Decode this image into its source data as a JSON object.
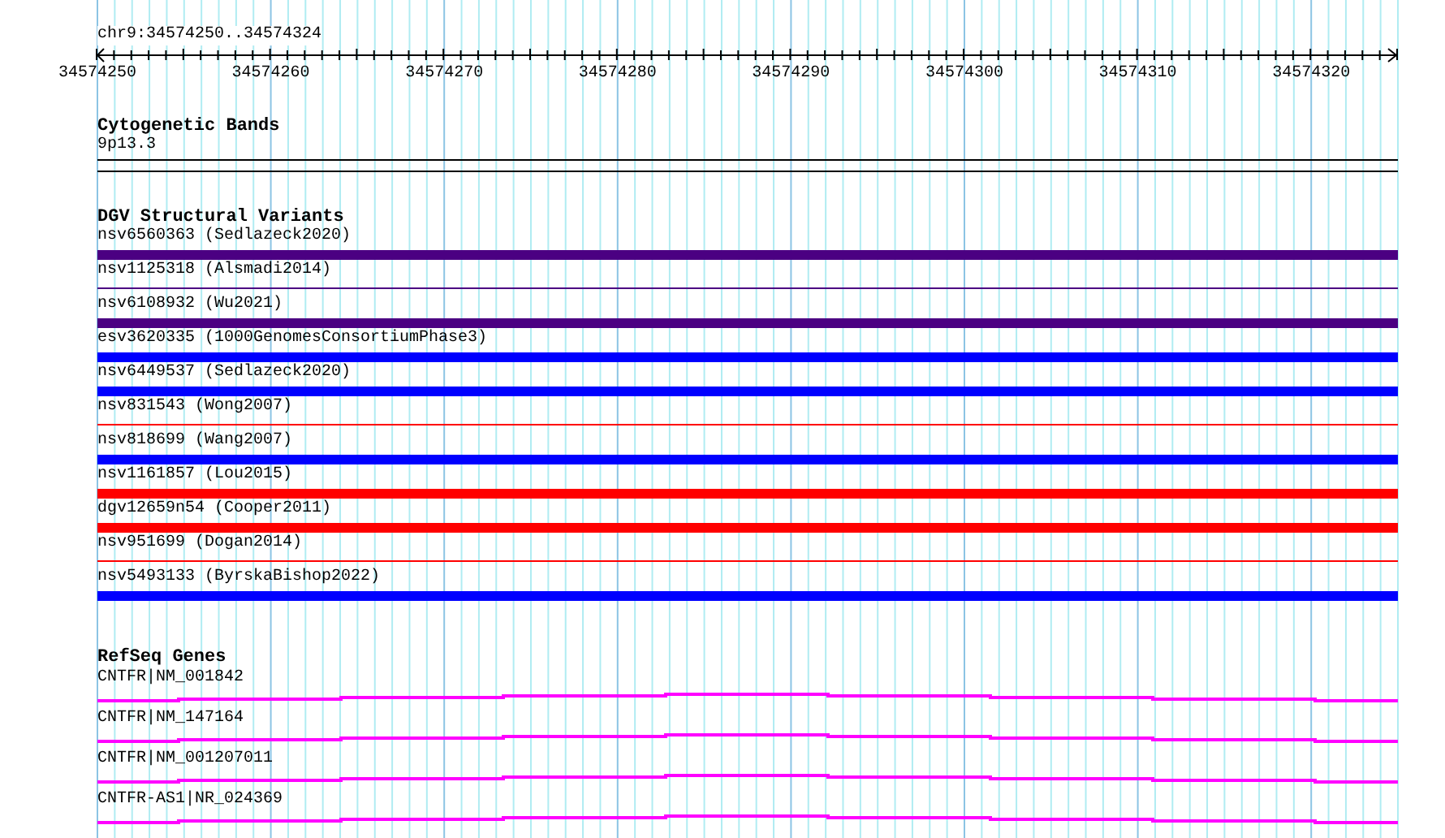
{
  "position": "chr9:34574250..34574324",
  "ruler": {
    "labels": [
      "34574250",
      "34574260",
      "34574270",
      "34574280",
      "34574290",
      "34574300",
      "34574310",
      "34574320"
    ]
  },
  "cytobands": {
    "title": "Cytogenetic Bands",
    "band": "9p13.3"
  },
  "variants": {
    "title": "DGV Structural Variants",
    "items": [
      {
        "label": "nsv6560363 (Sedlazeck2020)",
        "color": "#4b0082",
        "kind": "thick"
      },
      {
        "label": "nsv1125318 (Alsmadi2014)",
        "color": "#4b0082",
        "kind": "thin"
      },
      {
        "label": "nsv6108932 (Wu2021)",
        "color": "#4b0082",
        "kind": "thick"
      },
      {
        "label": "esv3620335 (1000GenomesConsortiumPhase3)",
        "color": "#0000ff",
        "kind": "thick"
      },
      {
        "label": "nsv6449537 (Sedlazeck2020)",
        "color": "#0000ff",
        "kind": "thick"
      },
      {
        "label": "nsv831543 (Wong2007)",
        "color": "#ff0000",
        "kind": "thin"
      },
      {
        "label": "nsv818699 (Wang2007)",
        "color": "#0000ff",
        "kind": "thick"
      },
      {
        "label": "nsv1161857 (Lou2015)",
        "color": "#ff0000",
        "kind": "thick"
      },
      {
        "label": "dgv12659n54 (Cooper2011)",
        "color": "#ff0000",
        "kind": "thick"
      },
      {
        "label": "nsv951699 (Dogan2014)",
        "color": "#ff0000",
        "kind": "thin"
      },
      {
        "label": "nsv5493133 (ByrskaBishop2022)",
        "color": "#0000ff",
        "kind": "thick"
      }
    ]
  },
  "genes": {
    "title": "RefSeq Genes",
    "items": [
      {
        "label": "CNTFR|NM_001842"
      },
      {
        "label": "CNTFR|NM_147164"
      },
      {
        "label": "CNTFR|NM_001207011"
      },
      {
        "label": "CNTFR-AS1|NR_024369"
      }
    ]
  }
}
